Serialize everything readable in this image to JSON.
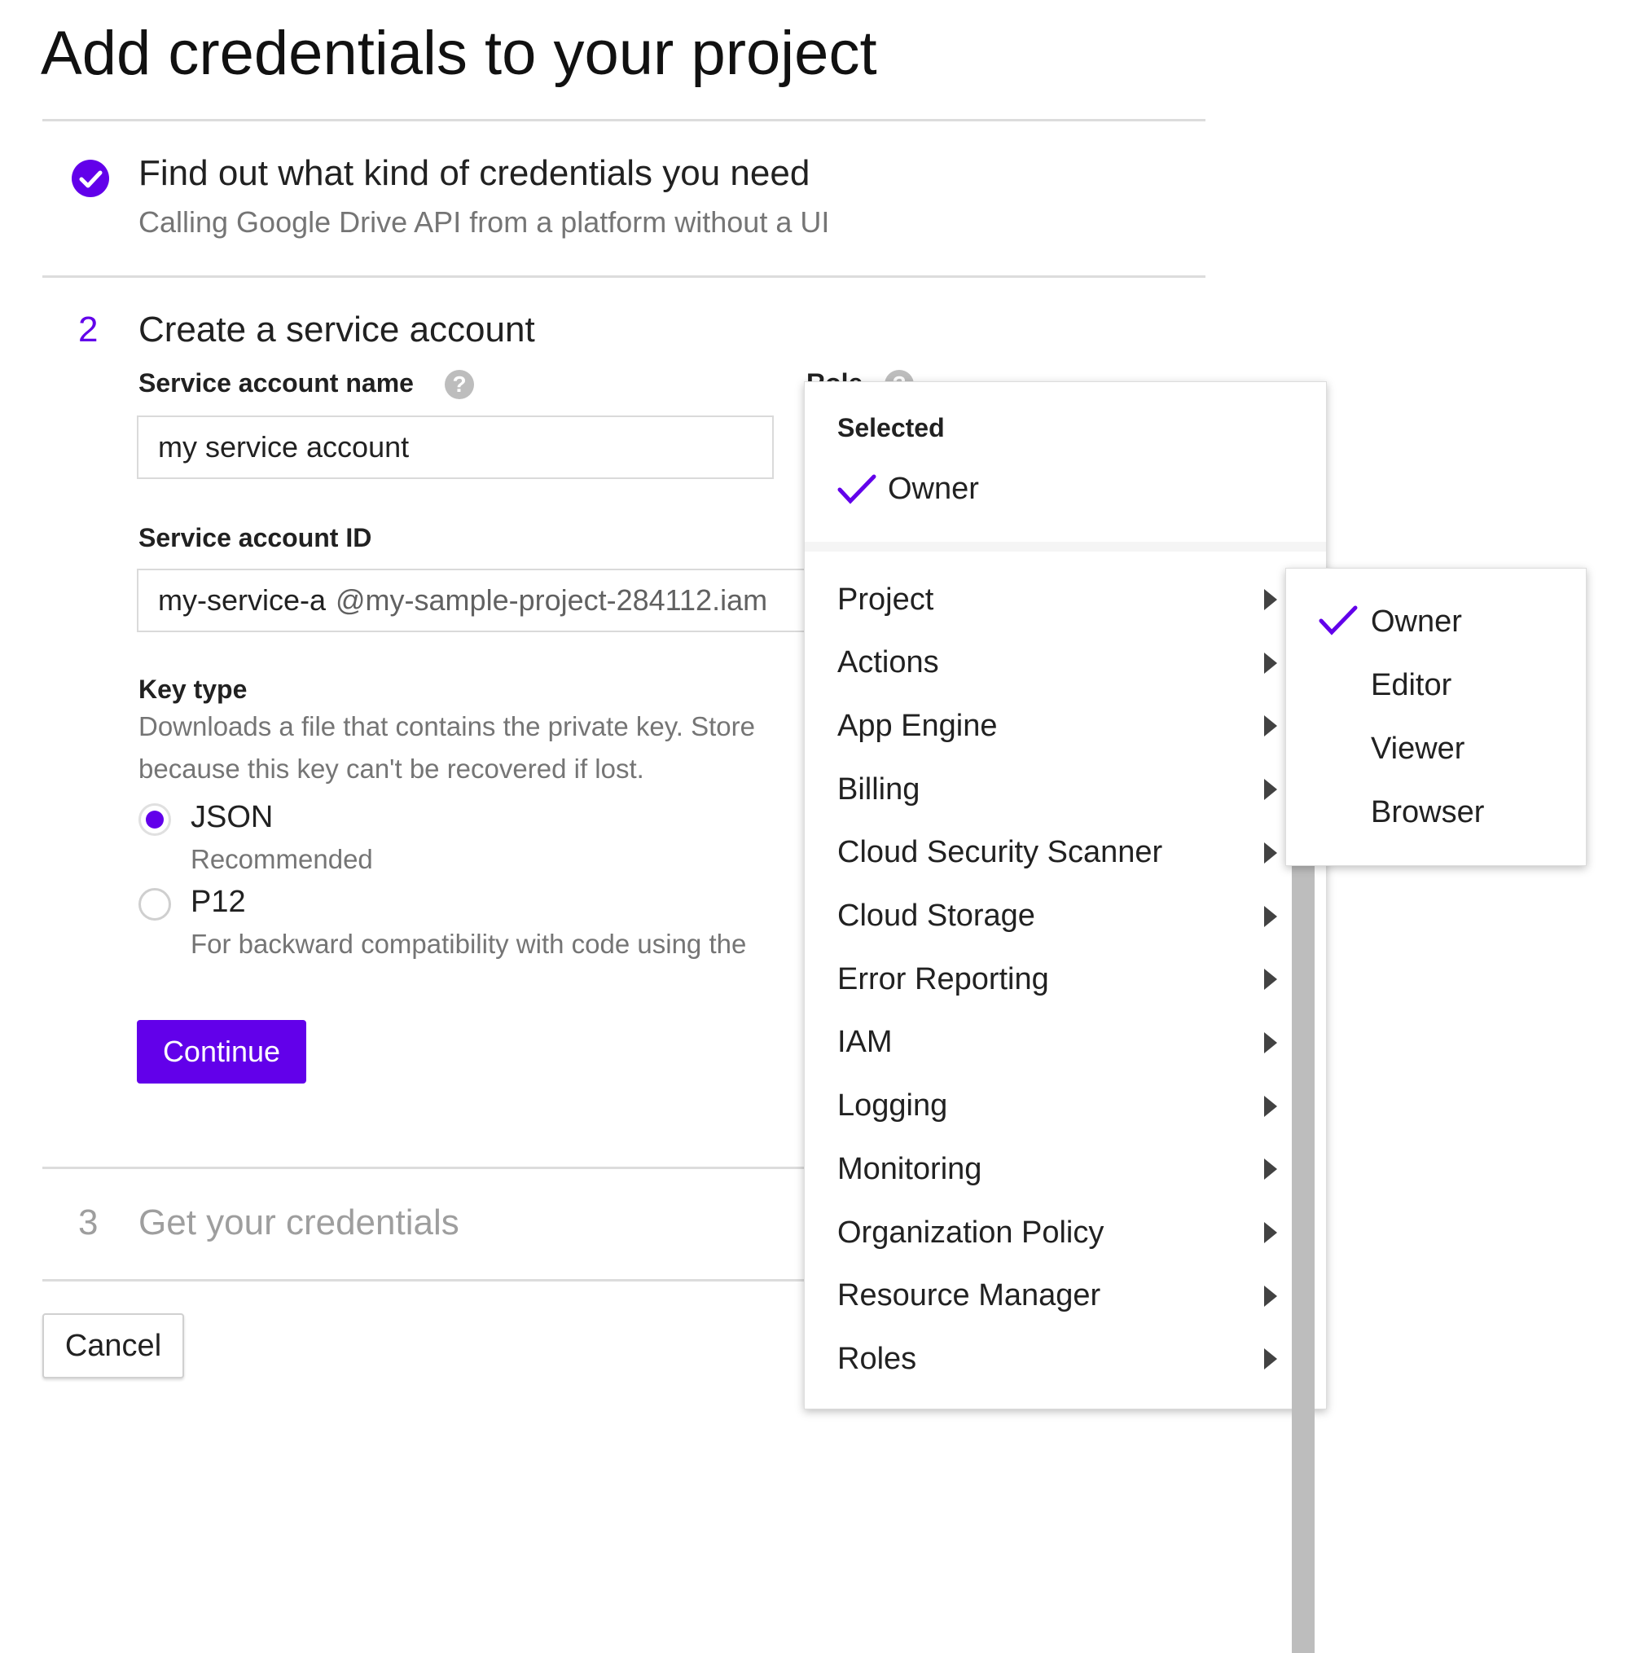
{
  "page": {
    "title": "Add credentials to your project"
  },
  "steps": {
    "step1": {
      "title": "Find out what kind of credentials you need",
      "subtitle": "Calling Google Drive API from a platform without a UI"
    },
    "step2": {
      "number": "2",
      "title": "Create a service account",
      "service_account_name_label": "Service account name",
      "service_account_name_value": "my service account",
      "role_label": "Role",
      "service_account_id_label": "Service account ID",
      "service_account_id_value": "my-service-a",
      "service_account_id_suffix": "@my-sample-project-284112.iam",
      "key_type_label": "Key type",
      "key_type_desc_1": "Downloads a file that contains the private key. Store",
      "key_type_desc_2": "because this key can't be recovered if lost.",
      "json_label": "JSON",
      "json_sub": "Recommended",
      "p12_label": "P12",
      "p12_sub": "For backward compatibility with code using the",
      "continue_label": "Continue"
    },
    "step3": {
      "number": "3",
      "title": "Get your credentials"
    }
  },
  "cancel_label": "Cancel",
  "role_menu": {
    "selected_header": "Selected",
    "selected_item": "Owner",
    "categories": [
      "Project",
      "Actions",
      "App Engine",
      "Billing",
      "Cloud Security Scanner",
      "Cloud Storage",
      "Error Reporting",
      "IAM",
      "Logging",
      "Monitoring",
      "Organization Policy",
      "Resource Manager",
      "Roles"
    ]
  },
  "project_submenu": {
    "items": [
      "Owner",
      "Editor",
      "Viewer",
      "Browser"
    ],
    "checked": "Owner"
  },
  "icons": {
    "step1": "check-circle-icon",
    "help": "help-icon",
    "checkmark": "checkmark-icon",
    "submenu": "chevron-right-icon"
  },
  "colors": {
    "accent": "#6200ea",
    "muted": "#757575"
  }
}
